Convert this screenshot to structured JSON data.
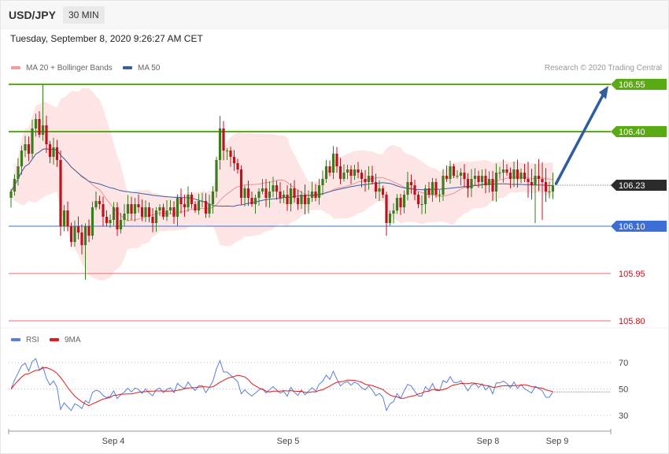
{
  "header": {
    "pair": "USD/JPY",
    "timeframe": "30 MIN"
  },
  "timestamp": "Tuesday, September 8, 2020 9:26:27 AM CET",
  "legend": {
    "ma20": "MA 20 + Bollinger Bands",
    "ma50": "MA 50",
    "rsi": "RSI",
    "rsi_ma": "9MA"
  },
  "credit": "Research © 2020 Trading Central",
  "colors": {
    "bull": "#3a7d1e",
    "bear": "#c0121b",
    "bollinger": "#fde0e0",
    "ma20": "#f09090",
    "ma50": "#3a5f9f",
    "resistance": "#5aaa14",
    "support": "#3b6fd6",
    "weak_support": "#f26a6a",
    "arrow": "#2f5d9e",
    "rsi": "#5a7fd6",
    "rsi_ma": "#e01b1b"
  },
  "chart_data": [
    {
      "type": "candlestick",
      "title": "USD/JPY 30 MIN",
      "x_labels": [
        "Sep 4",
        "Sep 5",
        "Sep 8",
        "Sep 9"
      ],
      "ylim": [
        105.8,
        106.6
      ],
      "current_price": "106.23",
      "levels": [
        {
          "label": "106.55",
          "value": 106.55,
          "kind": "resistance"
        },
        {
          "label": "106.40",
          "value": 106.4,
          "kind": "resistance"
        },
        {
          "label": "106.10",
          "value": 106.1,
          "kind": "support"
        },
        {
          "label": "105.95",
          "value": 105.95,
          "kind": "support"
        },
        {
          "label": "105.80",
          "value": 105.8,
          "kind": "support"
        }
      ],
      "forecast": {
        "from": 106.23,
        "to": 106.55
      },
      "close": [
        106.21,
        106.25,
        106.29,
        106.34,
        106.36,
        106.33,
        106.41,
        106.44,
        106.39,
        106.42,
        106.36,
        106.32,
        106.35,
        106.31,
        106.1,
        106.15,
        106.1,
        106.05,
        106.1,
        106.08,
        106.04,
        106.1,
        106.07,
        106.16,
        106.18,
        106.17,
        106.13,
        106.11,
        106.12,
        106.16,
        106.09,
        106.12,
        106.14,
        106.17,
        106.14,
        106.17,
        106.16,
        106.13,
        106.16,
        106.13,
        106.11,
        106.15,
        106.16,
        106.13,
        106.15,
        106.16,
        106.13,
        106.19,
        106.17,
        106.16,
        106.2,
        106.17,
        106.15,
        106.18,
        106.18,
        106.14,
        106.17,
        106.21,
        106.31,
        106.41,
        106.34,
        106.34,
        106.32,
        106.3,
        106.28,
        106.19,
        106.22,
        106.19,
        106.17,
        106.19,
        106.21,
        106.22,
        106.19,
        106.21,
        106.23,
        106.21,
        106.19,
        106.2,
        106.17,
        106.22,
        106.19,
        106.17,
        106.2,
        106.17,
        106.19,
        106.21,
        106.19,
        106.23,
        106.25,
        106.29,
        106.27,
        106.33,
        106.29,
        106.25,
        106.27,
        106.28,
        106.26,
        106.28,
        106.27,
        106.25,
        106.24,
        106.26,
        106.24,
        106.21,
        106.22,
        106.2,
        106.11,
        106.14,
        106.15,
        106.19,
        106.16,
        106.2,
        106.24,
        106.23,
        106.2,
        106.17,
        106.17,
        106.22,
        106.2,
        106.24,
        106.2,
        106.2,
        106.26,
        106.25,
        106.29,
        106.26,
        106.26,
        106.27,
        106.25,
        106.22,
        106.25,
        106.26,
        106.24,
        106.26,
        106.23,
        106.25,
        106.21,
        106.27,
        106.27,
        106.28,
        106.27,
        106.25,
        106.28,
        106.25,
        106.27,
        106.25,
        106.24,
        106.23,
        106.26,
        106.25,
        106.24,
        106.21,
        106.21,
        106.23
      ]
    },
    {
      "type": "line",
      "title": "RSI",
      "series": [
        {
          "name": "RSI"
        },
        {
          "name": "9MA"
        }
      ],
      "ylim": [
        20,
        80
      ],
      "y_ticks": [
        "70",
        "50",
        "30"
      ],
      "y_tick_values": [
        70,
        50,
        30
      ]
    }
  ]
}
